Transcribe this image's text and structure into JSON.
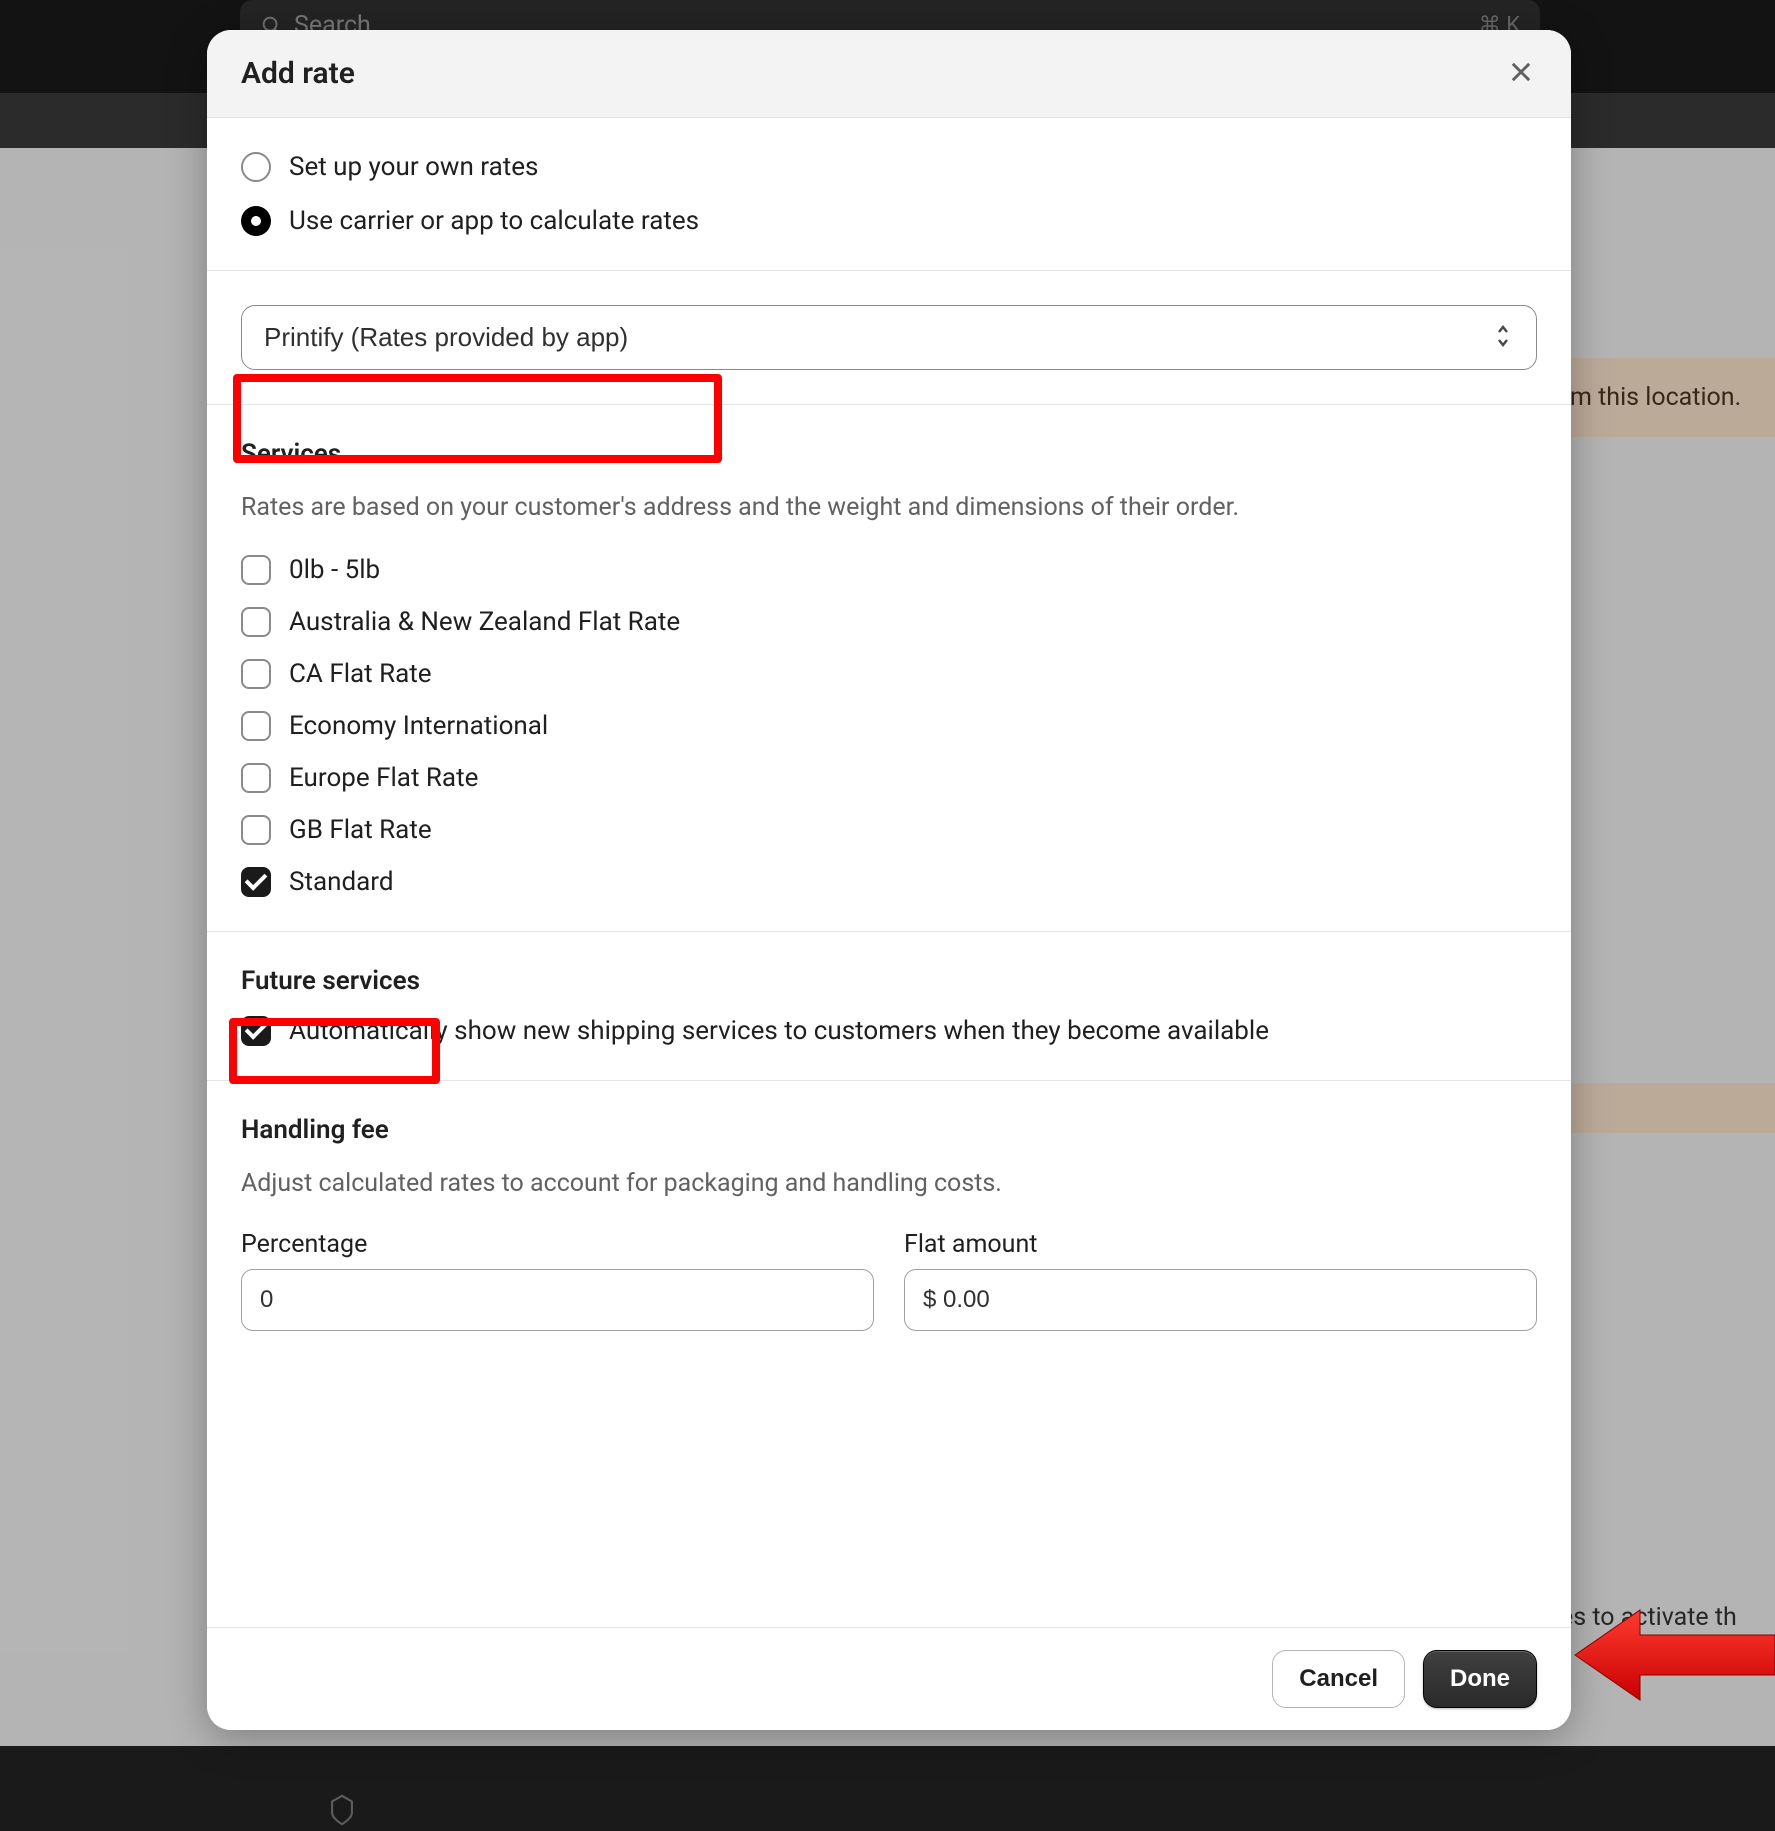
{
  "topbar": {
    "search_placeholder": "Search",
    "kbd_hint": "⌘ K"
  },
  "background": {
    "banner_right_1": "m this location.",
    "banner_right_2": "es to activate th"
  },
  "modal": {
    "title": "Add rate",
    "radios": {
      "own": "Set up your own rates",
      "carrier": "Use carrier or app to calculate rates",
      "selected": "carrier"
    },
    "carrier_select": {
      "value": "Printify (Rates provided by app)"
    },
    "services": {
      "title": "Services",
      "description": "Rates are based on your customer's address and the weight and dimensions of their order.",
      "items": [
        {
          "label": "0lb - 5lb",
          "checked": false
        },
        {
          "label": "Australia & New Zealand Flat Rate",
          "checked": false
        },
        {
          "label": "CA Flat Rate",
          "checked": false
        },
        {
          "label": "Economy International",
          "checked": false
        },
        {
          "label": "Europe Flat Rate",
          "checked": false
        },
        {
          "label": "GB Flat Rate",
          "checked": false
        },
        {
          "label": "Standard",
          "checked": true
        }
      ]
    },
    "future_services": {
      "title": "Future services",
      "auto_show_label": "Automatically show new shipping services to customers when they become available",
      "auto_show_checked": true
    },
    "handling_fee": {
      "title": "Handling fee",
      "description": "Adjust calculated rates to account for packaging and handling costs.",
      "percentage_label": "Percentage",
      "percentage_value": "0",
      "flat_label": "Flat amount",
      "flat_value": "$ 0.00"
    },
    "footer": {
      "cancel": "Cancel",
      "done": "Done"
    }
  }
}
